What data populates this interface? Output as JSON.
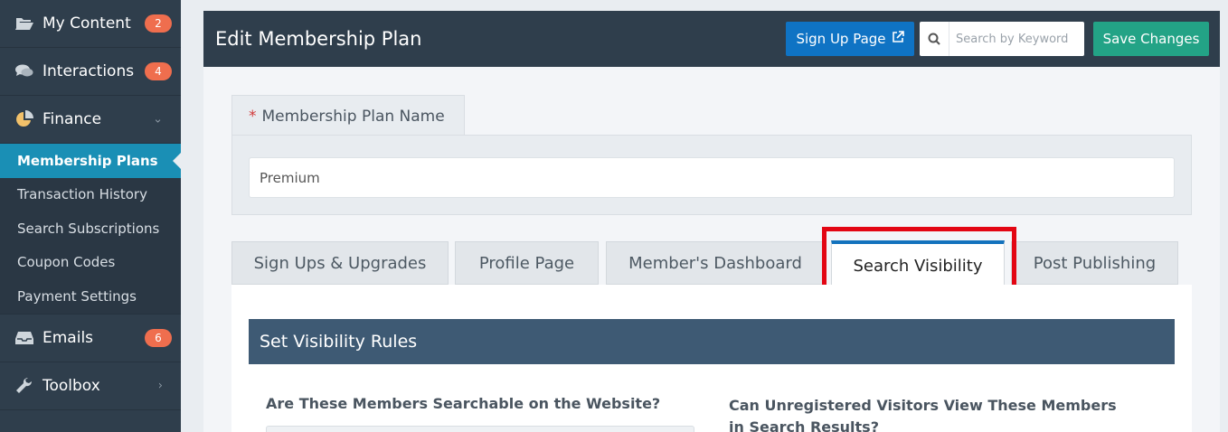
{
  "sidebar": {
    "items": [
      {
        "label": "My Content",
        "icon": "folder-open-icon",
        "badge": "2"
      },
      {
        "label": "Interactions",
        "icon": "comments-icon",
        "badge": "4"
      },
      {
        "label": "Finance",
        "icon": "pie-chart-icon",
        "chevron": "down"
      }
    ],
    "finance_sub": [
      {
        "label": "Membership Plans",
        "active": true
      },
      {
        "label": "Transaction History"
      },
      {
        "label": "Search Subscriptions"
      },
      {
        "label": "Coupon Codes"
      },
      {
        "label": "Payment Settings"
      }
    ],
    "bottom_items": [
      {
        "label": "Emails",
        "icon": "inbox-icon",
        "badge": "6"
      },
      {
        "label": "Toolbox",
        "icon": "wrench-icon",
        "chevron": "right"
      }
    ]
  },
  "header": {
    "title": "Edit Membership Plan",
    "signup_label": "Sign Up Page",
    "search_placeholder": "Search by Keyword",
    "save_label": "Save Changes"
  },
  "form": {
    "name_label": "Membership Plan Name",
    "required_mark": "*",
    "name_value": "Premium"
  },
  "tabs": [
    {
      "label": "Sign Ups & Upgrades"
    },
    {
      "label": "Profile Page"
    },
    {
      "label": "Member's Dashboard"
    },
    {
      "label": "Search Visibility",
      "active": true
    },
    {
      "label": "Post Publishing"
    }
  ],
  "content": {
    "section_title": "Set Visibility Rules",
    "question_1": "Are These Members Searchable on the Website?",
    "question_2": "Can Unregistered Visitors View These Members in Search Results?"
  },
  "colors": {
    "sidebar_bg": "#2f3e4c",
    "active_sub": "#1a8fb5",
    "badge": "#ef6e4e",
    "signup_btn": "#0f73c4",
    "save_btn": "#23a386",
    "highlight": "#e30613"
  }
}
